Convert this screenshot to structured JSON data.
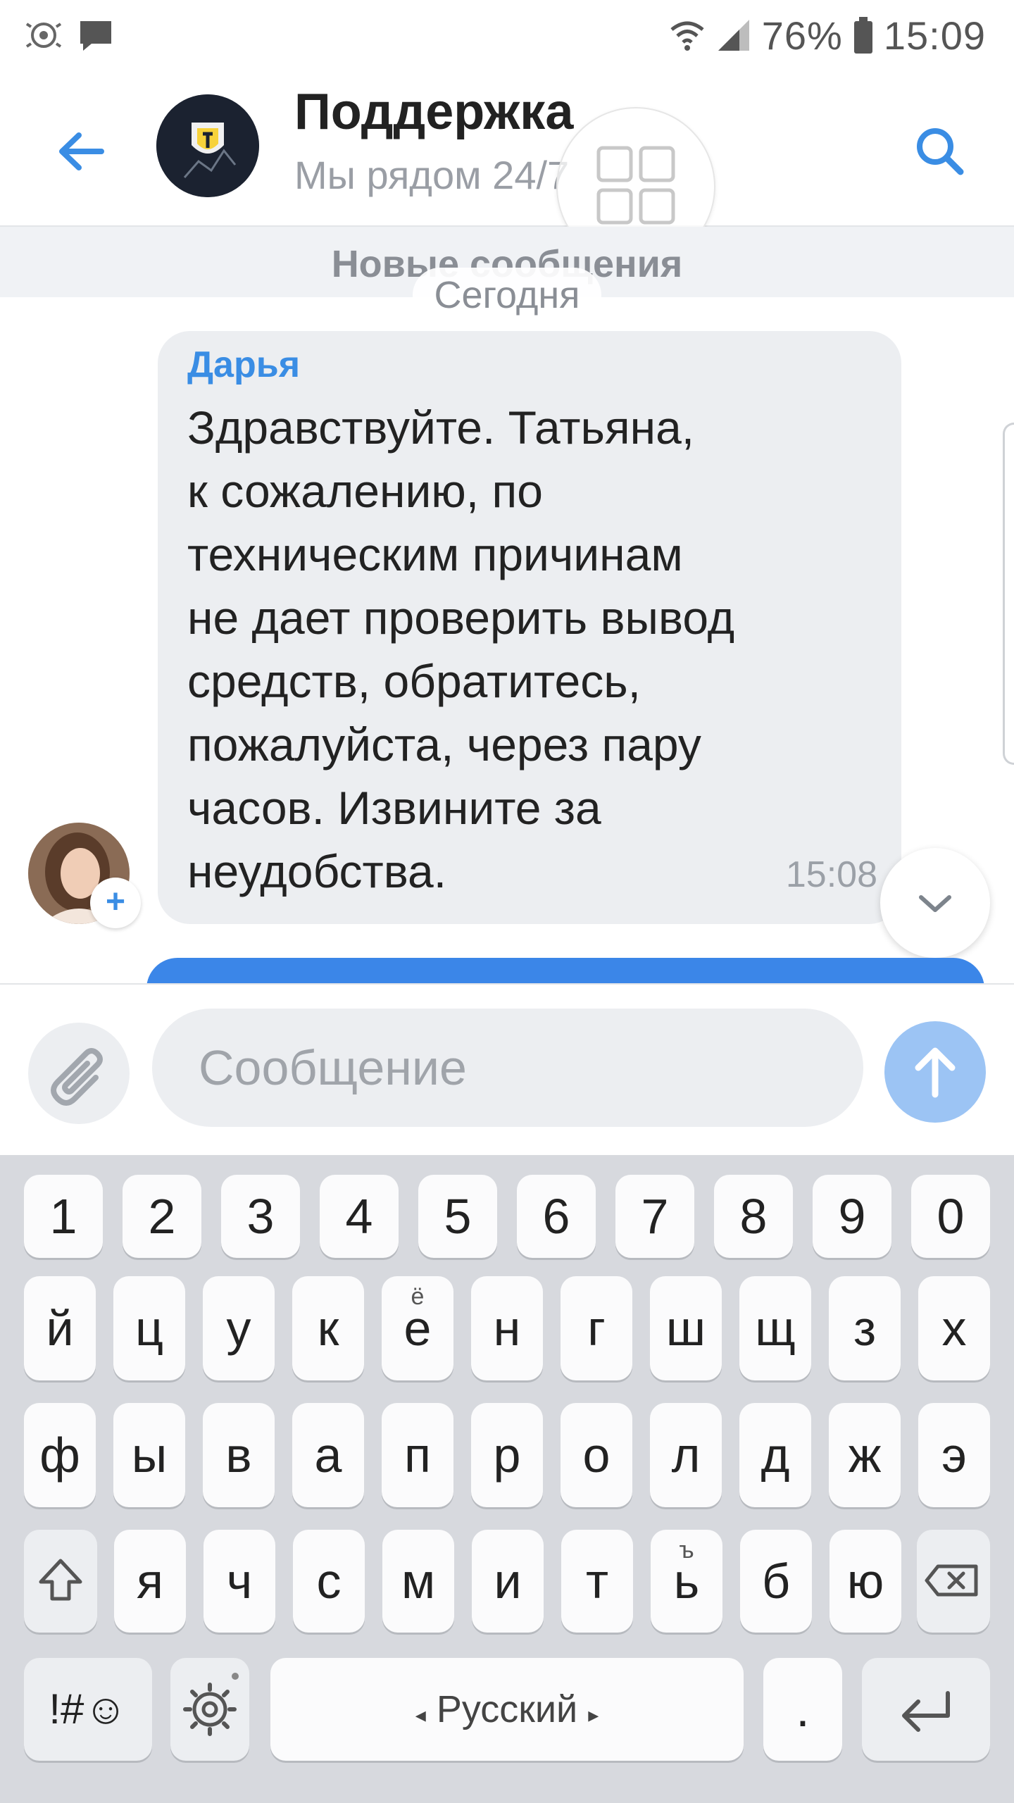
{
  "status_bar": {
    "battery": "76%",
    "time": "15:09",
    "icons": [
      "app-icon",
      "message-icon",
      "wifi-icon",
      "signal-icon",
      "battery-icon"
    ]
  },
  "header": {
    "title": "Поддержка",
    "subtitle": "Мы рядом 24/7"
  },
  "chat": {
    "new_messages_label": "Новые сообщения",
    "date_badge": "Сегодня",
    "message": {
      "sender": "Дарья",
      "text": "Здравствуйте. Татьяна,\nк сожалению, по\nтехническим причинам\nне дает проверить вывод\nсредств, обратитесь,\nпожалуйста, через пару\nчасов. Извините за\nнеудобства.",
      "time": "15:08"
    },
    "avatar_badge": "+"
  },
  "composer": {
    "placeholder": "Сообщение"
  },
  "keyboard": {
    "row_numbers": [
      "1",
      "2",
      "3",
      "4",
      "5",
      "6",
      "7",
      "8",
      "9",
      "0"
    ],
    "row1": [
      {
        "main": "й",
        "sub": ""
      },
      {
        "main": "ц",
        "sub": ""
      },
      {
        "main": "у",
        "sub": ""
      },
      {
        "main": "к",
        "sub": ""
      },
      {
        "main": "е",
        "sub": "ё"
      },
      {
        "main": "н",
        "sub": ""
      },
      {
        "main": "г",
        "sub": ""
      },
      {
        "main": "ш",
        "sub": ""
      },
      {
        "main": "щ",
        "sub": ""
      },
      {
        "main": "з",
        "sub": ""
      },
      {
        "main": "х",
        "sub": ""
      }
    ],
    "row2": [
      {
        "main": "ф",
        "sub": ""
      },
      {
        "main": "ы",
        "sub": ""
      },
      {
        "main": "в",
        "sub": ""
      },
      {
        "main": "а",
        "sub": ""
      },
      {
        "main": "п",
        "sub": ""
      },
      {
        "main": "р",
        "sub": ""
      },
      {
        "main": "о",
        "sub": ""
      },
      {
        "main": "л",
        "sub": ""
      },
      {
        "main": "д",
        "sub": ""
      },
      {
        "main": "ж",
        "sub": ""
      },
      {
        "main": "э",
        "sub": ""
      }
    ],
    "row3": [
      {
        "main": "я",
        "sub": ""
      },
      {
        "main": "ч",
        "sub": ""
      },
      {
        "main": "с",
        "sub": ""
      },
      {
        "main": "м",
        "sub": ""
      },
      {
        "main": "и",
        "sub": ""
      },
      {
        "main": "т",
        "sub": ""
      },
      {
        "main": "ь",
        "sub": "ъ"
      },
      {
        "main": "б",
        "sub": ""
      },
      {
        "main": "ю",
        "sub": ""
      }
    ],
    "symbols_label": "!#☺",
    "language_label": "Русский",
    "period": "."
  }
}
